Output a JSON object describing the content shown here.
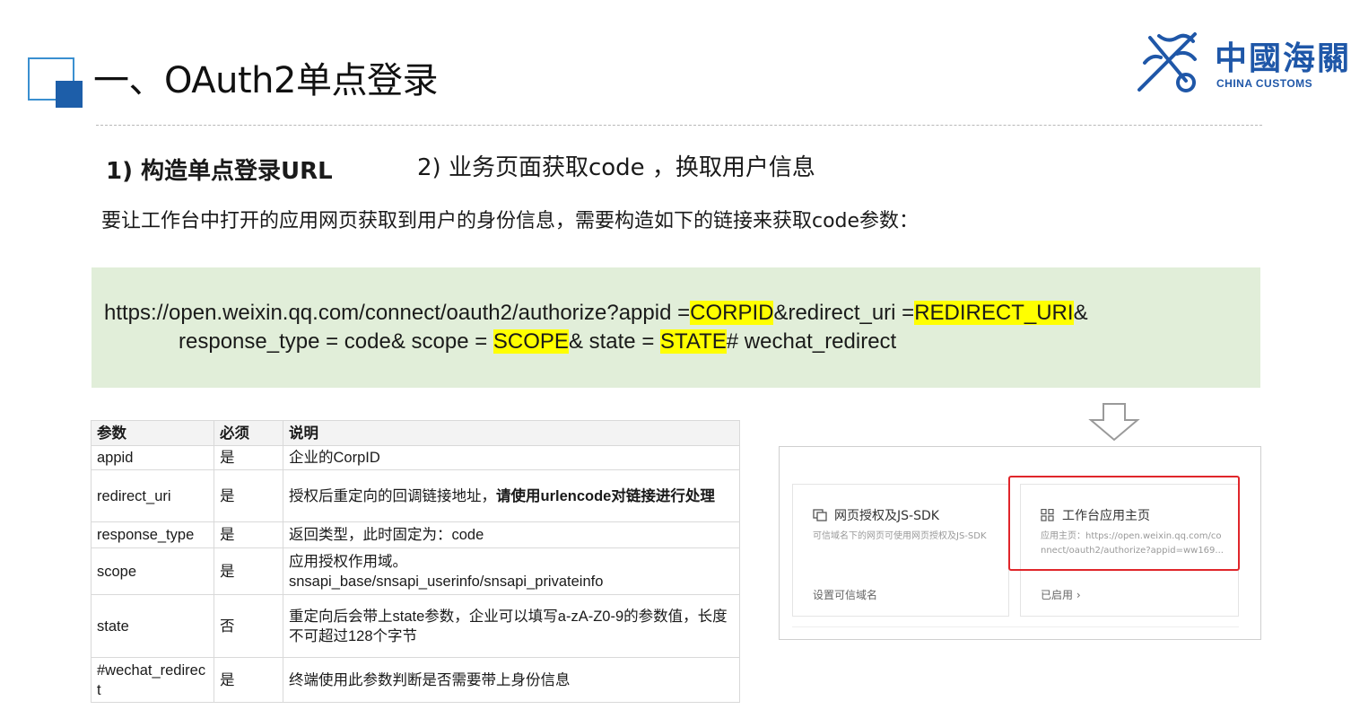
{
  "header": {
    "title": "一、OAuth2单点登录"
  },
  "logo": {
    "cn": "中國海關",
    "en": "CHINA CUSTOMS"
  },
  "steps": {
    "step1": "1) 构造单点登录URL",
    "step2": "2) 业务页面获取code ，换取用户信息"
  },
  "intro": "要让工作台中打开的应用网页获取到用户的身份信息，需要构造如下的链接来获取code参数：",
  "url": {
    "p1": "https://open.weixin.qq.com/connect/oauth2/authorize?appid =",
    "corpid": "CORPID",
    "p2": "&redirect_uri =",
    "redirect": "REDIRECT_URI",
    "p3": "&",
    "p4": "response_type = code& scope = ",
    "scope": "SCOPE",
    "p5": "& state = ",
    "state": "STATE",
    "p6": "# wechat_redirect"
  },
  "table": {
    "headers": [
      "参数",
      "必须",
      "说明"
    ],
    "rows": [
      {
        "name": "appid",
        "req": "是",
        "desc": "企业的CorpID",
        "desc_bold": ""
      },
      {
        "name": "redirect_uri",
        "req": "是",
        "desc": "授权后重定向的回调链接地址，",
        "desc_bold": "请使用urlencode对链接进行处理"
      },
      {
        "name": "response_type",
        "req": "是",
        "desc": "返回类型，此时固定为：code",
        "desc_bold": ""
      },
      {
        "name": "scope",
        "req": "是",
        "desc": "应用授权作用域。",
        "desc2": "snsapi_base/snsapi_userinfo/snsapi_privateinfo"
      },
      {
        "name": "state",
        "req": "否",
        "desc": "重定向后会带上state参数，企业可以填写a-zA-Z0-9的参数值，长度不可超过128个字节",
        "desc_bold": ""
      },
      {
        "name": "#wechat_redirect",
        "req": "是",
        "desc": "终端使用此参数判断是否需要带上身份信息",
        "desc_bold": ""
      }
    ]
  },
  "panel": {
    "cardA": {
      "title": "网页授权及JS-SDK",
      "desc": "可信域名下的网页可使用网页授权及JS-SDK",
      "link": "设置可信域名"
    },
    "cardB": {
      "title": "工作台应用主页",
      "desc": "应用主页：https://open.weixin.qq.com/connect/oauth2/authorize?appid=ww169...",
      "link": "已启用 ›"
    }
  },
  "colors": {
    "accent": "#1d5ea9",
    "highlight": "#ffff00",
    "url_bg": "#e1eed9",
    "red_frame": "#e0262b"
  }
}
